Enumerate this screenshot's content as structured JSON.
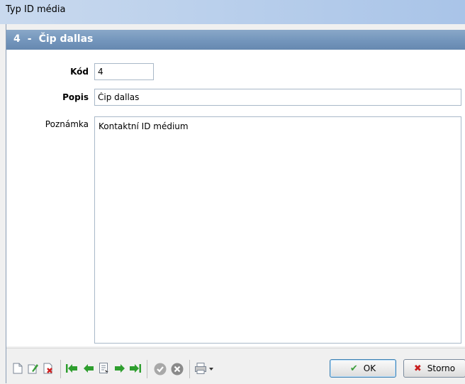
{
  "window": {
    "title": "Typ ID média"
  },
  "record": {
    "id": "4",
    "separator": "-",
    "name": "Čip dallas"
  },
  "form": {
    "kod_label": "Kód",
    "kod_value": "4",
    "popis_label": "Popis",
    "popis_value": "Čip dallas",
    "poznamka_label": "Poznámka",
    "poznamka_value": "Kontaktní ID médium"
  },
  "buttons": {
    "ok": "OK",
    "storno": "Storno"
  },
  "icons": {
    "new": "new-document-icon",
    "edit": "edit-document-icon",
    "delete": "delete-document-icon",
    "first": "first-record-icon",
    "prev": "previous-record-icon",
    "detail": "detail-icon",
    "next": "next-record-icon",
    "last": "last-record-icon",
    "confirm": "confirm-icon",
    "cancel": "cancel-icon",
    "print": "print-icon"
  },
  "colors": {
    "header": "#7597bd",
    "titlebar": "#bcd1ec",
    "navigation_green": "#2e9e2e",
    "ok_check": "#3a9d3a",
    "storno_x": "#c81e1e"
  }
}
